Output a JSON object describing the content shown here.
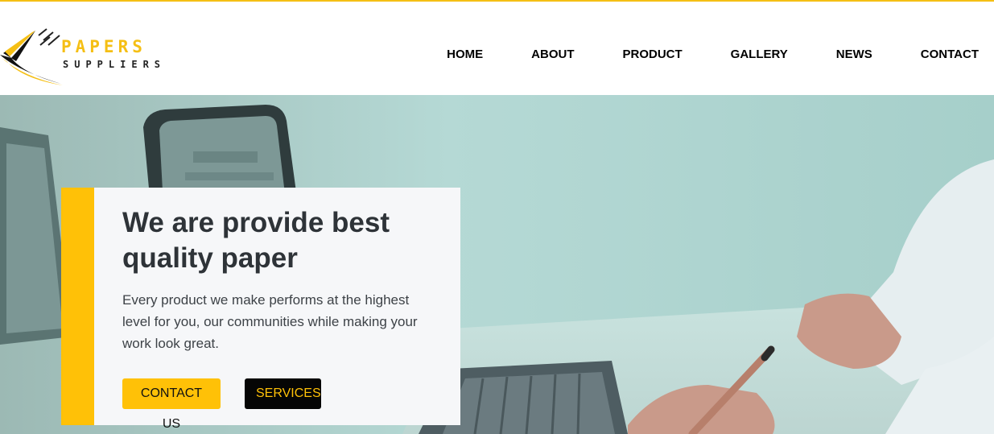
{
  "brand": {
    "name_line1": "PAPERS",
    "name_line2": "SUPPLIERS",
    "logo_icon": "paper-swoosh-icon",
    "accent_color": "#f5bf14"
  },
  "nav": {
    "items": [
      {
        "label": "HOME"
      },
      {
        "label": "ABOUT"
      },
      {
        "label": "PRODUCT"
      },
      {
        "label": "GALLERY"
      },
      {
        "label": "NEWS"
      },
      {
        "label": "CONTACT"
      }
    ]
  },
  "hero": {
    "title": "We are provide best quality paper",
    "description": "Every product we make performs at the highest level for you, our communities while making your work look great.",
    "contact_button": "CONTACT US",
    "services_button": "SERVICES",
    "card_accent_color": "#ffc107",
    "services_button_color": "#050505"
  }
}
